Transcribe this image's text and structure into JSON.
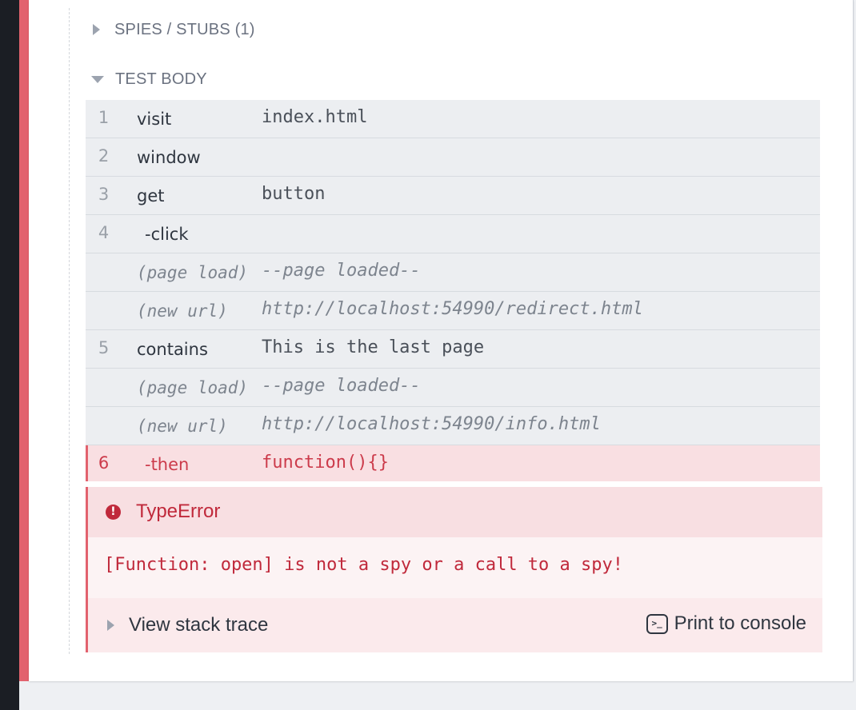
{
  "spies_section": {
    "label": "SPIES / STUBS (1)"
  },
  "test_body_section": {
    "label": "TEST BODY"
  },
  "commands": [
    {
      "num": "1",
      "name": "visit",
      "message": "index.html",
      "kind": "command"
    },
    {
      "num": "2",
      "name": "window",
      "message": "",
      "kind": "command"
    },
    {
      "num": "3",
      "name": "get",
      "message": "button",
      "kind": "command"
    },
    {
      "num": "4",
      "name": "-click",
      "message": "",
      "kind": "child"
    },
    {
      "num": "",
      "name": "(page load)",
      "message": "--page loaded--",
      "kind": "event"
    },
    {
      "num": "",
      "name": "(new url)",
      "message": "http://localhost:54990/redirect.html",
      "kind": "event"
    },
    {
      "num": "5",
      "name": "contains",
      "message": "This is the last page",
      "kind": "command"
    },
    {
      "num": "",
      "name": "(page load)",
      "message": "--page loaded--",
      "kind": "event"
    },
    {
      "num": "",
      "name": "(new url)",
      "message": "http://localhost:54990/info.html",
      "kind": "event"
    },
    {
      "num": "6",
      "name": "-then",
      "message": "function(){}",
      "kind": "failed"
    }
  ],
  "error": {
    "name": "TypeError",
    "message": "[Function: open] is not a spy or a call to a spy!",
    "stack_label": "View stack trace",
    "print_label": "Print to console",
    "print_icon": "terminal-icon",
    "icon": "exclamation-circle-icon",
    "color": "#c0293b"
  },
  "colors": {
    "fail_border": "#e2626e",
    "row_bg": "#eceef1",
    "failed_row_bg": "#f9dfe2"
  }
}
